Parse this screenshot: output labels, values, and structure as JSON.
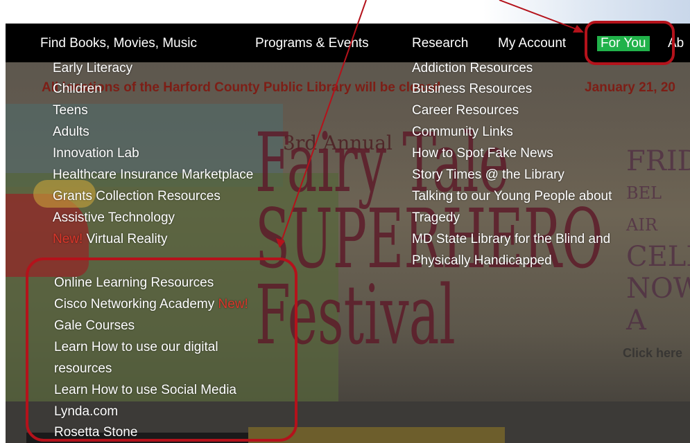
{
  "nav": {
    "items": [
      "Find Books, Movies, Music",
      "Programs & Events",
      "Research",
      "My Account",
      "For You",
      "Ab"
    ]
  },
  "background": {
    "announcement": "All locations of the Harford County Public Library will be closed",
    "date": "January 21, 20",
    "poster_sup": "3rd Annual",
    "poster_lines": [
      "Fairy Tale",
      "SUPERHERO",
      "Festival"
    ],
    "right_lines": [
      "FRID",
      "BEL AIR",
      "CELEBR",
      "NOW A"
    ],
    "right_small": "Click here"
  },
  "menu_left": [
    "Early Literacy",
    "Children",
    "Teens",
    "Adults",
    "Innovation Lab",
    "Healthcare Insurance Marketplace",
    "Grants Collection Resources",
    "Assistive Technology"
  ],
  "virtual_reality": {
    "new_tag": "New!",
    "label": "Virtual Reality"
  },
  "menu_online": [
    "Online Learning Resources",
    "Cisco Networking Academy",
    "Gale Courses",
    "Learn How to use our digital",
    "resources",
    "Learn How to use Social Media",
    "Lynda.com",
    "Rosetta Stone"
  ],
  "cisco_new_tag": "New!",
  "menu_right": [
    "Addiction Resources",
    "Business Resources",
    "Career Resources",
    "Community Links",
    "How to Spot Fake News",
    "Story Times @ the Library",
    "Talking to our Young People about",
    "Tragedy",
    "MD State Library for the Blind and",
    "Physically Handicapped"
  ],
  "colors": {
    "nav_bg": "#000000",
    "highlight": "#21b24a",
    "annotation": "#b4121b",
    "new_tag": "#d9362a"
  }
}
